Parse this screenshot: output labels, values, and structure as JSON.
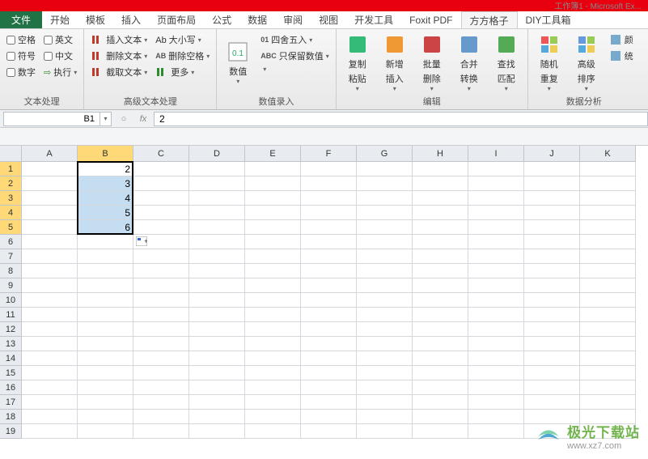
{
  "titlebar": {
    "right": "工作簿1 - Microsoft Ex..."
  },
  "tabs": {
    "file": "文件",
    "items": [
      "开始",
      "模板",
      "插入",
      "页面布局",
      "公式",
      "数据",
      "审阅",
      "视图",
      "开发工具",
      "Foxit PDF",
      "方方格子",
      "DIY工具箱"
    ],
    "active": "方方格子"
  },
  "ribbon": {
    "g1": {
      "label": "文本处理",
      "col1": [
        {
          "label": "空格",
          "checked": false
        },
        {
          "label": "符号",
          "checked": false
        },
        {
          "label": "数字",
          "checked": false
        }
      ],
      "col2": [
        {
          "label": "英文",
          "checked": false
        },
        {
          "label": "中文",
          "checked": false
        },
        {
          "label": "执行",
          "arrow": true,
          "color": "#2e8b2e"
        }
      ]
    },
    "g2": {
      "label": "高级文本处理",
      "col1": [
        {
          "label": "插入文本",
          "icon": "#c0392b"
        },
        {
          "label": "删除文本",
          "icon": "#c0392b"
        },
        {
          "label": "截取文本",
          "icon": "#c0392b"
        }
      ],
      "col2": [
        {
          "label": "Ab 大小写"
        },
        {
          "label": "删除空格",
          "prefix": "AB"
        },
        {
          "label": "更多",
          "icon": "#2e8b2e"
        }
      ]
    },
    "g3": {
      "label": "数值录入",
      "big": "数值",
      "col": [
        {
          "label": "四舍五入",
          "prefix": "01"
        },
        {
          "label": "只保留数值",
          "prefix": "ABC"
        },
        {
          "label": ""
        }
      ]
    },
    "g4": {
      "label": "编辑",
      "items": [
        "复制\n粘贴",
        "新增\n插入",
        "批量\n删除",
        "合并\n转换",
        "查找\n匹配"
      ]
    },
    "g5": {
      "label": "数据分析",
      "items": [
        "随机\n重复",
        "高级\n排序"
      ],
      "extra": [
        "颜",
        "统"
      ]
    }
  },
  "namebox": {
    "ref": "B1",
    "formula": "2"
  },
  "columns": [
    "A",
    "B",
    "C",
    "D",
    "E",
    "F",
    "G",
    "H",
    "I",
    "J",
    "K"
  ],
  "rows": 19,
  "selection": {
    "col": 1,
    "startRow": 0,
    "endRow": 4
  },
  "cells": {
    "B1": "2",
    "B2": "3",
    "B3": "4",
    "B4": "5",
    "B5": "6"
  },
  "watermark": {
    "main": "极光下载站",
    "sub": "www.xz7.com"
  }
}
